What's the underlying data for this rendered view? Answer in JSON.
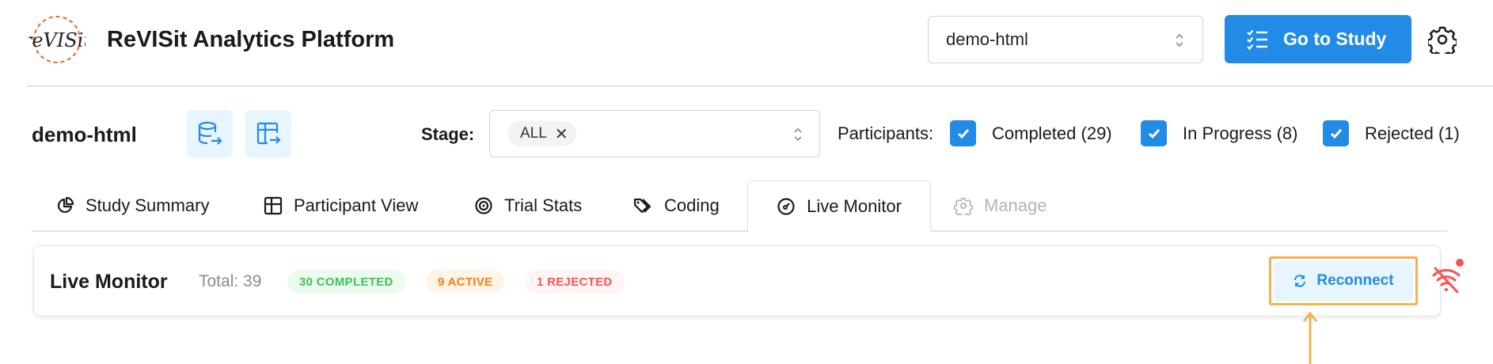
{
  "header": {
    "app_title": "ReVISit Analytics Platform",
    "logo_alt": "reVISit",
    "study_select_value": "demo-html",
    "go_button_label": "Go to Study"
  },
  "filters": {
    "study_name": "demo-html",
    "stage_label": "Stage:",
    "stage_value": "ALL",
    "participants_label": "Participants:",
    "checkboxes": [
      {
        "label": "Completed (29)",
        "checked": true
      },
      {
        "label": "In Progress (8)",
        "checked": true
      },
      {
        "label": "Rejected (1)",
        "checked": true
      }
    ]
  },
  "tabs": [
    {
      "label": "Study Summary",
      "icon": "pie-chart-icon"
    },
    {
      "label": "Participant View",
      "icon": "table-icon"
    },
    {
      "label": "Trial Stats",
      "icon": "target-icon"
    },
    {
      "label": "Coding",
      "icon": "tags-icon"
    },
    {
      "label": "Live Monitor",
      "icon": "gauge-icon",
      "active": true
    },
    {
      "label": "Manage",
      "icon": "gear-icon",
      "disabled": true
    }
  ],
  "live_monitor": {
    "title": "Live Monitor",
    "total": "Total: 39",
    "badges": {
      "completed": "30 COMPLETED",
      "active": "9 ACTIVE",
      "rejected": "1 REJECTED"
    },
    "reconnect_label": "Reconnect"
  },
  "colors": {
    "primary": "#228be6",
    "primary_light": "#e7f5ff",
    "highlight": "#f6b14d",
    "green": "#40c057",
    "orange": "#fd7e14",
    "red": "#fa5252"
  }
}
